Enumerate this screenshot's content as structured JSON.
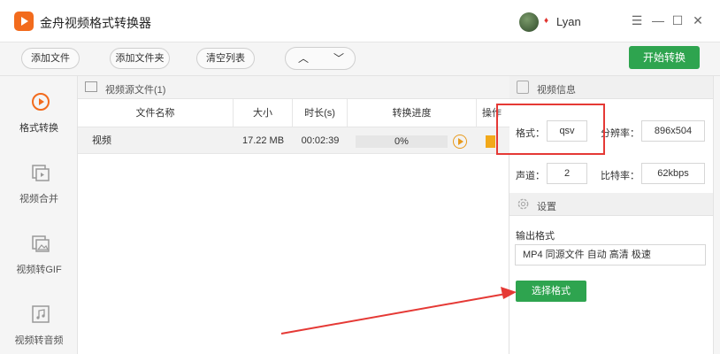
{
  "app": {
    "title": "金舟视频格式转换器",
    "user_name": "Lyan",
    "brand_color": "#f26b1d"
  },
  "window_controls": {
    "menu": "☰",
    "minimize": "—",
    "maximize": "☐",
    "close": "✕"
  },
  "toolbar": {
    "add_file": "添加文件",
    "add_folder": "添加文件夹",
    "clear_list": "清空列表",
    "move_up": "︿",
    "move_down": "﹀",
    "start_convert": "开始转换",
    "accent_color": "#2ea44f"
  },
  "sidebar": {
    "items": [
      {
        "label": "格式转换",
        "icon": "format-convert-icon",
        "active": true
      },
      {
        "label": "视频合并",
        "icon": "video-merge-icon",
        "active": false
      },
      {
        "label": "视频转GIF",
        "icon": "video-gif-icon",
        "active": false
      },
      {
        "label": "视频转音频",
        "icon": "video-audio-icon",
        "active": false
      }
    ]
  },
  "file_list": {
    "header": "视频源文件(1)",
    "columns": [
      "文件名称",
      "大小",
      "时长(s)",
      "转换进度",
      "操作"
    ],
    "rows": [
      {
        "name": "视频",
        "size": "17.22 MB",
        "duration": "00:02:39",
        "progress": "0%",
        "progress_value": 0
      }
    ]
  },
  "video_info": {
    "header": "视频信息",
    "format_label": "格式：",
    "format_value": "qsv",
    "resolution_label": "分辨率：",
    "resolution_value": "896x504",
    "channel_label": "声道：",
    "channel_value": "2",
    "bitrate_label": "比特率：",
    "bitrate_value": "62kbps"
  },
  "settings": {
    "header": "设置",
    "output_format_label": "输出格式",
    "output_format_value": "MP4 同源文件 自动 高清 极速",
    "select_format_button": "选择格式"
  }
}
